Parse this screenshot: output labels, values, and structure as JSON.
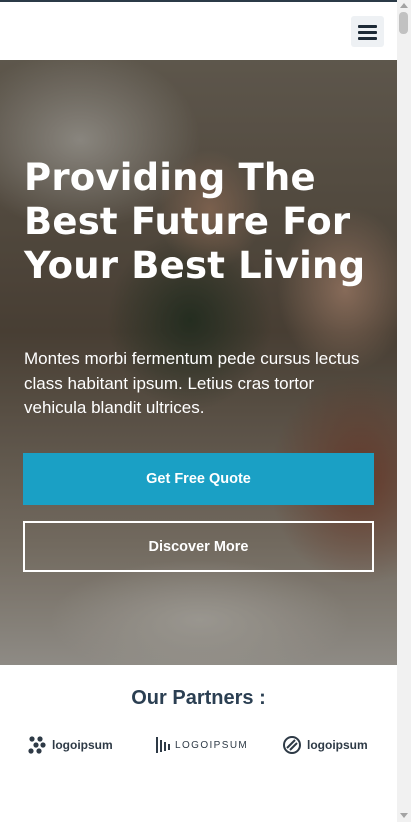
{
  "header": {
    "menu_icon": "hamburger-menu-icon"
  },
  "hero": {
    "title": "Providing The Best Future For Your Best Living",
    "text": "Montes morbi fermentum pede cursus lectus class habitant ipsum. Letius cras tortor vehicula blandit ultrices.",
    "primary_button": "Get Free Quote",
    "secondary_button": "Discover More"
  },
  "partners": {
    "title": "Our Partners :",
    "logos": [
      {
        "icon": "logoipsum-dots-icon",
        "text": "logoipsum"
      },
      {
        "icon": "logoipsum-bars-icon",
        "text": "LOGOIPSUM"
      },
      {
        "icon": "logoipsum-circle-icon",
        "text": "logoipsum"
      }
    ]
  },
  "colors": {
    "accent": "#1aa0c5",
    "heading": "#2b3f52",
    "header_bg": "#ffffff"
  }
}
